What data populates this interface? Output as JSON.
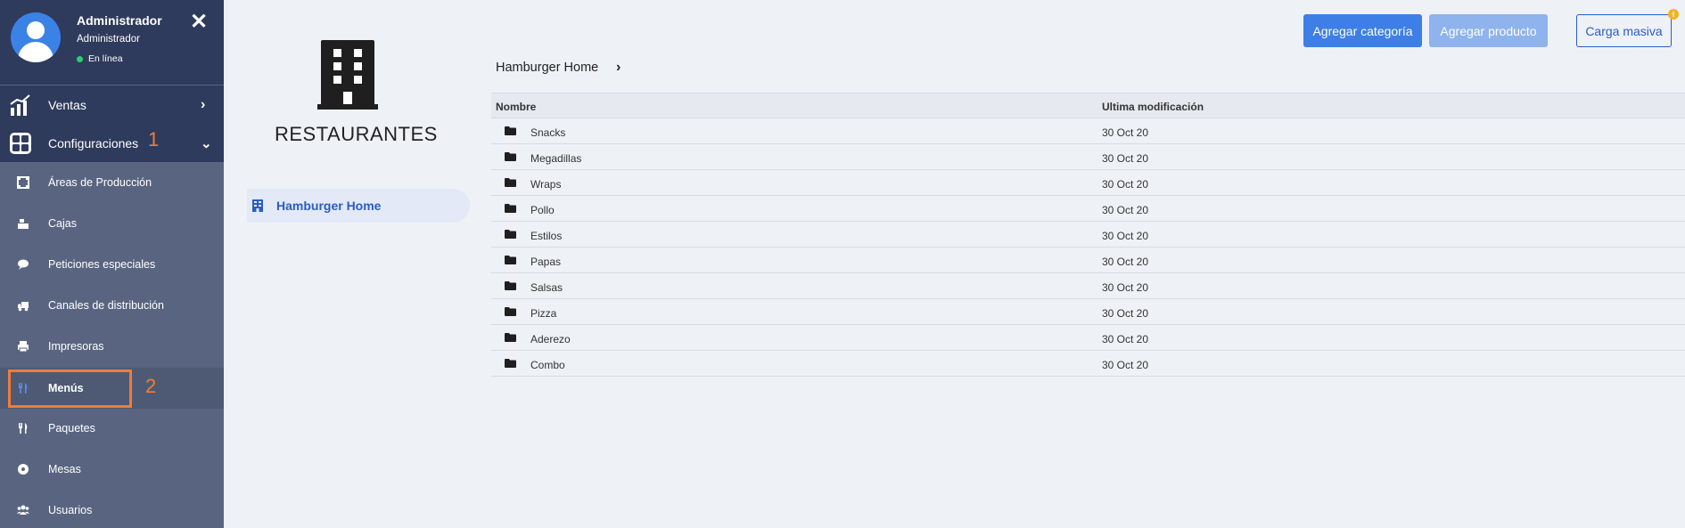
{
  "profile": {
    "name": "Administrador",
    "role": "Administrador",
    "status": "En línea"
  },
  "nav": {
    "ventas": "Ventas",
    "configuraciones": "Configuraciones",
    "step1": "1",
    "step2": "2",
    "sub_items": [
      {
        "label": "Áreas de Producción",
        "icon": "production-area-icon"
      },
      {
        "label": "Cajas",
        "icon": "cash-register-icon"
      },
      {
        "label": "Peticiones especiales",
        "icon": "comment-icon"
      },
      {
        "label": "Canales de distribución",
        "icon": "truck-icon"
      },
      {
        "label": "Impresoras",
        "icon": "printer-icon"
      },
      {
        "label": "Menús",
        "icon": "utensils-icon",
        "active": true
      },
      {
        "label": "Paquetes",
        "icon": "utensils-icon"
      },
      {
        "label": "Mesas",
        "icon": "table-icon"
      },
      {
        "label": "Usuarios",
        "icon": "users-icon"
      }
    ]
  },
  "restaurants": {
    "title": "RESTAURANTES",
    "items": [
      "Hamburger Home"
    ]
  },
  "toolbar": {
    "add_category": "Agregar categoría",
    "add_product": "Agregar producto",
    "bulk_load": "Carga masiva",
    "info_badge": "i"
  },
  "breadcrumb": {
    "current": "Hamburger Home"
  },
  "table": {
    "columns": [
      "Nombre",
      "Ultima modificación"
    ],
    "rows": [
      {
        "name": "Snacks",
        "date": "30 Oct 20"
      },
      {
        "name": "Megadillas",
        "date": "30 Oct 20"
      },
      {
        "name": "Wraps",
        "date": "30 Oct 20"
      },
      {
        "name": "Pollo",
        "date": "30 Oct 20"
      },
      {
        "name": "Estilos",
        "date": "30 Oct 20"
      },
      {
        "name": "Papas",
        "date": "30 Oct 20"
      },
      {
        "name": "Salsas",
        "date": "30 Oct 20"
      },
      {
        "name": "Pizza",
        "date": "30 Oct 20"
      },
      {
        "name": "Aderezo",
        "date": "30 Oct 20"
      },
      {
        "name": "Combo",
        "date": "30 Oct 20"
      }
    ]
  },
  "colors": {
    "accent": "#3d7fe6",
    "sidebar": "#596580",
    "sidebar_header": "#2f3b5c",
    "annotation": "#f07c3a"
  }
}
